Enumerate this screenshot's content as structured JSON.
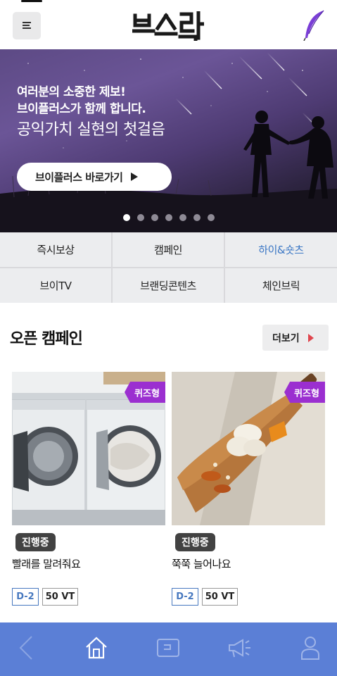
{
  "header": {
    "logo_text": "브스락",
    "menu_icon": "hamburger-menu-icon",
    "quill_icon": "quill-pen-icon"
  },
  "banner": {
    "line1": "여러분의 소중한 제보!",
    "line2": "브이플러스가 함께 합니다.",
    "line3": "공익가치 실현의 첫걸음",
    "button_label": "브이플러스 바로가기",
    "slide_count": 7,
    "active_slide": 1
  },
  "categories": [
    {
      "label": "즉시보상"
    },
    {
      "label": "캠페인"
    },
    {
      "label": "하이&숏츠"
    },
    {
      "label": "브이TV"
    },
    {
      "label": "브랜딩콘텐츠"
    },
    {
      "label": "체인브릭"
    }
  ],
  "section": {
    "title": "오픈 캠페인",
    "more_label": "더보기"
  },
  "cards": [
    {
      "tag": "퀴즈형",
      "status": "진행중",
      "title": "빨래를 말려줘요",
      "dday": "D-2",
      "reward": "50 VT"
    },
    {
      "tag": "퀴즈형",
      "status": "진행중",
      "title": "쭉쭉 늘어나요",
      "dday": "D-2",
      "reward": "50 VT"
    }
  ],
  "bottom_nav": {
    "items": [
      "back-icon",
      "home-icon",
      "wallet-icon",
      "megaphone-icon",
      "profile-icon"
    ]
  },
  "colors": {
    "accent_purple": "#9b2fd0",
    "nav_blue": "#5b7fd6",
    "link_blue": "#3a76c4",
    "more_red": "#e0454d"
  }
}
